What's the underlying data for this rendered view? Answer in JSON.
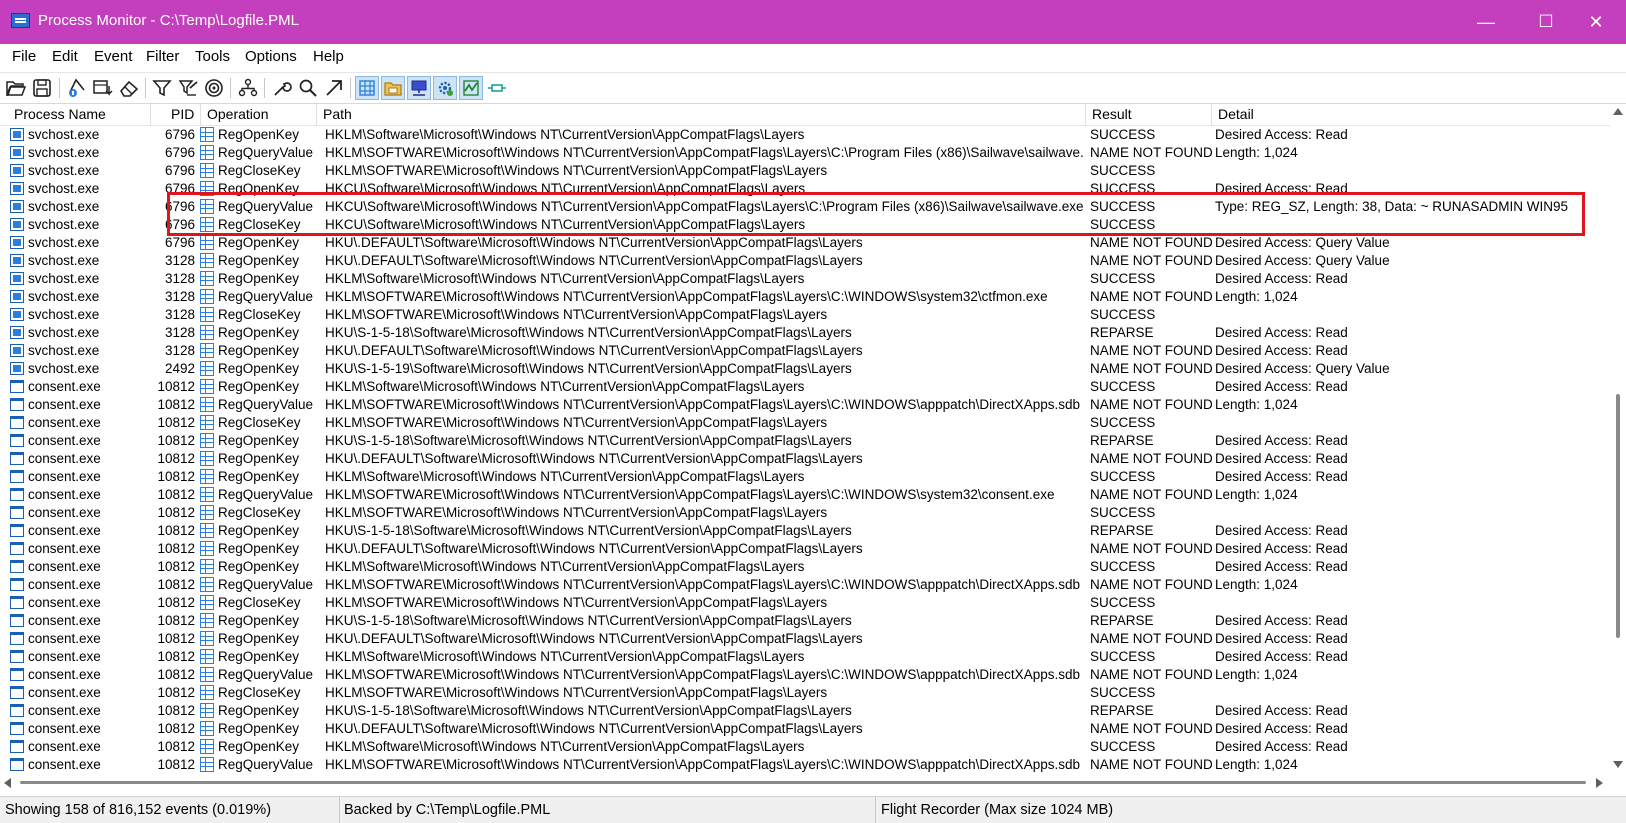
{
  "window": {
    "title": "Process Monitor - C:\\Temp\\Logfile.PML",
    "minimize": "—",
    "maximize": "☐",
    "close": "✕"
  },
  "menu": [
    "File",
    "Edit",
    "Event",
    "Filter",
    "Tools",
    "Options",
    "Help"
  ],
  "toolbar": [
    "open-icon",
    "save-icon",
    "capture-icon",
    "autoscroll-icon",
    "clear-icon",
    "filter-icon",
    "highlight-icon",
    "include-process-icon",
    "process-tree-icon",
    "properties-icon",
    "find-icon",
    "jump-icon",
    "show-registry-icon",
    "show-filesystem-icon",
    "show-network-icon",
    "show-process-icon",
    "show-profiling-icon",
    "bookmark-icon"
  ],
  "columns": {
    "process": "Process Name",
    "pid": "PID",
    "operation": "Operation",
    "path": "Path",
    "result": "Result",
    "detail": "Detail"
  },
  "rows": [
    [
      "svchost.exe",
      "6796",
      "RegOpenKey",
      "HKLM\\Software\\Microsoft\\Windows NT\\CurrentVersion\\AppCompatFlags\\Layers",
      "SUCCESS",
      "Desired Access: Read"
    ],
    [
      "svchost.exe",
      "6796",
      "RegQueryValue",
      "HKLM\\SOFTWARE\\Microsoft\\Windows NT\\CurrentVersion\\AppCompatFlags\\Layers\\C:\\Program Files (x86)\\Sailwave\\sailwave...",
      "NAME NOT FOUND",
      "Length: 1,024"
    ],
    [
      "svchost.exe",
      "6796",
      "RegCloseKey",
      "HKLM\\SOFTWARE\\Microsoft\\Windows NT\\CurrentVersion\\AppCompatFlags\\Layers",
      "SUCCESS",
      ""
    ],
    [
      "svchost.exe",
      "6796",
      "RegOpenKey",
      "HKCU\\Software\\Microsoft\\Windows NT\\CurrentVersion\\AppCompatFlags\\Layers",
      "SUCCESS",
      "Desired Access: Read"
    ],
    [
      "svchost.exe",
      "6796",
      "RegQueryValue",
      "HKCU\\Software\\Microsoft\\Windows NT\\CurrentVersion\\AppCompatFlags\\Layers\\C:\\Program Files (x86)\\Sailwave\\sailwave.exe",
      "SUCCESS",
      "Type: REG_SZ, Length: 38, Data: ~ RUNASADMIN WIN95"
    ],
    [
      "svchost.exe",
      "6796",
      "RegCloseKey",
      "HKCU\\Software\\Microsoft\\Windows NT\\CurrentVersion\\AppCompatFlags\\Layers",
      "SUCCESS",
      ""
    ],
    [
      "svchost.exe",
      "6796",
      "RegOpenKey",
      "HKU\\.DEFAULT\\Software\\Microsoft\\Windows NT\\CurrentVersion\\AppCompatFlags\\Layers",
      "NAME NOT FOUND",
      "Desired Access: Query Value"
    ],
    [
      "svchost.exe",
      "3128",
      "RegOpenKey",
      "HKU\\.DEFAULT\\Software\\Microsoft\\Windows NT\\CurrentVersion\\AppCompatFlags\\Layers",
      "NAME NOT FOUND",
      "Desired Access: Query Value"
    ],
    [
      "svchost.exe",
      "3128",
      "RegOpenKey",
      "HKLM\\Software\\Microsoft\\Windows NT\\CurrentVersion\\AppCompatFlags\\Layers",
      "SUCCESS",
      "Desired Access: Read"
    ],
    [
      "svchost.exe",
      "3128",
      "RegQueryValue",
      "HKLM\\SOFTWARE\\Microsoft\\Windows NT\\CurrentVersion\\AppCompatFlags\\Layers\\C:\\WINDOWS\\system32\\ctfmon.exe",
      "NAME NOT FOUND",
      "Length: 1,024"
    ],
    [
      "svchost.exe",
      "3128",
      "RegCloseKey",
      "HKLM\\SOFTWARE\\Microsoft\\Windows NT\\CurrentVersion\\AppCompatFlags\\Layers",
      "SUCCESS",
      ""
    ],
    [
      "svchost.exe",
      "3128",
      "RegOpenKey",
      "HKU\\S-1-5-18\\Software\\Microsoft\\Windows NT\\CurrentVersion\\AppCompatFlags\\Layers",
      "REPARSE",
      "Desired Access: Read"
    ],
    [
      "svchost.exe",
      "3128",
      "RegOpenKey",
      "HKU\\.DEFAULT\\Software\\Microsoft\\Windows NT\\CurrentVersion\\AppCompatFlags\\Layers",
      "NAME NOT FOUND",
      "Desired Access: Read"
    ],
    [
      "svchost.exe",
      "2492",
      "RegOpenKey",
      "HKU\\S-1-5-19\\Software\\Microsoft\\Windows NT\\CurrentVersion\\AppCompatFlags\\Layers",
      "NAME NOT FOUND",
      "Desired Access: Query Value"
    ],
    [
      "consent.exe",
      "10812",
      "RegOpenKey",
      "HKLM\\Software\\Microsoft\\Windows NT\\CurrentVersion\\AppCompatFlags\\Layers",
      "SUCCESS",
      "Desired Access: Read"
    ],
    [
      "consent.exe",
      "10812",
      "RegQueryValue",
      "HKLM\\SOFTWARE\\Microsoft\\Windows NT\\CurrentVersion\\AppCompatFlags\\Layers\\C:\\WINDOWS\\apppatch\\DirectXApps.sdb",
      "NAME NOT FOUND",
      "Length: 1,024"
    ],
    [
      "consent.exe",
      "10812",
      "RegCloseKey",
      "HKLM\\SOFTWARE\\Microsoft\\Windows NT\\CurrentVersion\\AppCompatFlags\\Layers",
      "SUCCESS",
      ""
    ],
    [
      "consent.exe",
      "10812",
      "RegOpenKey",
      "HKU\\S-1-5-18\\Software\\Microsoft\\Windows NT\\CurrentVersion\\AppCompatFlags\\Layers",
      "REPARSE",
      "Desired Access: Read"
    ],
    [
      "consent.exe",
      "10812",
      "RegOpenKey",
      "HKU\\.DEFAULT\\Software\\Microsoft\\Windows NT\\CurrentVersion\\AppCompatFlags\\Layers",
      "NAME NOT FOUND",
      "Desired Access: Read"
    ],
    [
      "consent.exe",
      "10812",
      "RegOpenKey",
      "HKLM\\Software\\Microsoft\\Windows NT\\CurrentVersion\\AppCompatFlags\\Layers",
      "SUCCESS",
      "Desired Access: Read"
    ],
    [
      "consent.exe",
      "10812",
      "RegQueryValue",
      "HKLM\\SOFTWARE\\Microsoft\\Windows NT\\CurrentVersion\\AppCompatFlags\\Layers\\C:\\WINDOWS\\system32\\consent.exe",
      "NAME NOT FOUND",
      "Length: 1,024"
    ],
    [
      "consent.exe",
      "10812",
      "RegCloseKey",
      "HKLM\\SOFTWARE\\Microsoft\\Windows NT\\CurrentVersion\\AppCompatFlags\\Layers",
      "SUCCESS",
      ""
    ],
    [
      "consent.exe",
      "10812",
      "RegOpenKey",
      "HKU\\S-1-5-18\\Software\\Microsoft\\Windows NT\\CurrentVersion\\AppCompatFlags\\Layers",
      "REPARSE",
      "Desired Access: Read"
    ],
    [
      "consent.exe",
      "10812",
      "RegOpenKey",
      "HKU\\.DEFAULT\\Software\\Microsoft\\Windows NT\\CurrentVersion\\AppCompatFlags\\Layers",
      "NAME NOT FOUND",
      "Desired Access: Read"
    ],
    [
      "consent.exe",
      "10812",
      "RegOpenKey",
      "HKLM\\Software\\Microsoft\\Windows NT\\CurrentVersion\\AppCompatFlags\\Layers",
      "SUCCESS",
      "Desired Access: Read"
    ],
    [
      "consent.exe",
      "10812",
      "RegQueryValue",
      "HKLM\\SOFTWARE\\Microsoft\\Windows NT\\CurrentVersion\\AppCompatFlags\\Layers\\C:\\WINDOWS\\apppatch\\DirectXApps.sdb",
      "NAME NOT FOUND",
      "Length: 1,024"
    ],
    [
      "consent.exe",
      "10812",
      "RegCloseKey",
      "HKLM\\SOFTWARE\\Microsoft\\Windows NT\\CurrentVersion\\AppCompatFlags\\Layers",
      "SUCCESS",
      ""
    ],
    [
      "consent.exe",
      "10812",
      "RegOpenKey",
      "HKU\\S-1-5-18\\Software\\Microsoft\\Windows NT\\CurrentVersion\\AppCompatFlags\\Layers",
      "REPARSE",
      "Desired Access: Read"
    ],
    [
      "consent.exe",
      "10812",
      "RegOpenKey",
      "HKU\\.DEFAULT\\Software\\Microsoft\\Windows NT\\CurrentVersion\\AppCompatFlags\\Layers",
      "NAME NOT FOUND",
      "Desired Access: Read"
    ],
    [
      "consent.exe",
      "10812",
      "RegOpenKey",
      "HKLM\\Software\\Microsoft\\Windows NT\\CurrentVersion\\AppCompatFlags\\Layers",
      "SUCCESS",
      "Desired Access: Read"
    ],
    [
      "consent.exe",
      "10812",
      "RegQueryValue",
      "HKLM\\SOFTWARE\\Microsoft\\Windows NT\\CurrentVersion\\AppCompatFlags\\Layers\\C:\\WINDOWS\\apppatch\\DirectXApps.sdb",
      "NAME NOT FOUND",
      "Length: 1,024"
    ],
    [
      "consent.exe",
      "10812",
      "RegCloseKey",
      "HKLM\\SOFTWARE\\Microsoft\\Windows NT\\CurrentVersion\\AppCompatFlags\\Layers",
      "SUCCESS",
      ""
    ],
    [
      "consent.exe",
      "10812",
      "RegOpenKey",
      "HKU\\S-1-5-18\\Software\\Microsoft\\Windows NT\\CurrentVersion\\AppCompatFlags\\Layers",
      "REPARSE",
      "Desired Access: Read"
    ],
    [
      "consent.exe",
      "10812",
      "RegOpenKey",
      "HKU\\.DEFAULT\\Software\\Microsoft\\Windows NT\\CurrentVersion\\AppCompatFlags\\Layers",
      "NAME NOT FOUND",
      "Desired Access: Read"
    ],
    [
      "consent.exe",
      "10812",
      "RegOpenKey",
      "HKLM\\Software\\Microsoft\\Windows NT\\CurrentVersion\\AppCompatFlags\\Layers",
      "SUCCESS",
      "Desired Access: Read"
    ],
    [
      "consent.exe",
      "10812",
      "RegQueryValue",
      "HKLM\\SOFTWARE\\Microsoft\\Windows NT\\CurrentVersion\\AppCompatFlags\\Layers\\C:\\WINDOWS\\apppatch\\DirectXApps.sdb",
      "NAME NOT FOUND",
      "Length: 1,024"
    ]
  ],
  "status": {
    "events": "Showing 158 of 816,152 events (0.019%)",
    "backing": "Backed by C:\\Temp\\Logfile.PML",
    "recorder": "Flight Recorder (Max size 1024 MB)"
  },
  "colors": {
    "titlebar": "#c33fbd",
    "highlight_border": "#e0141c",
    "icon_blue": "#2b7de0"
  }
}
